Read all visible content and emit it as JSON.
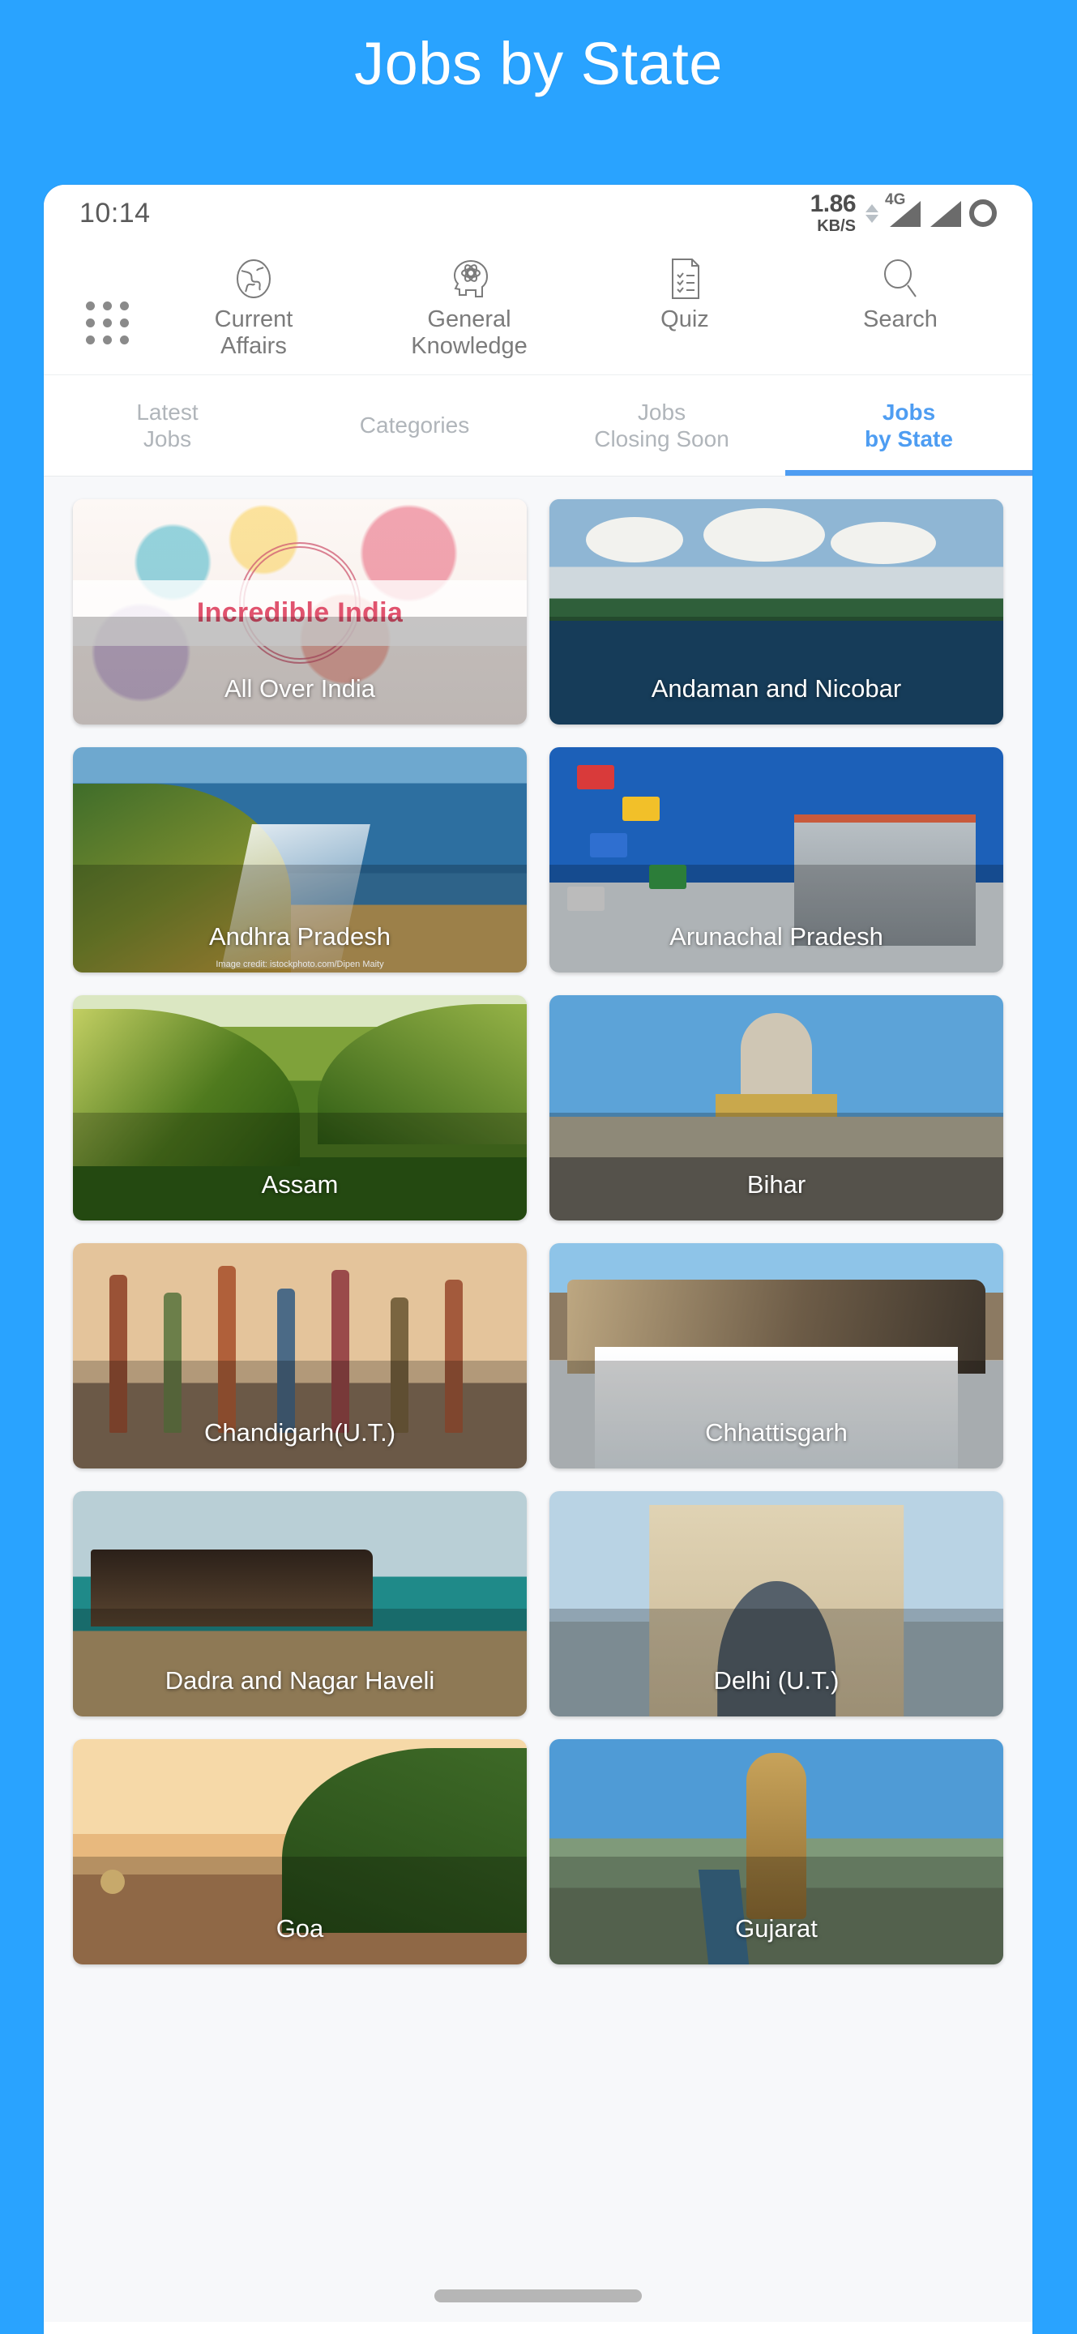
{
  "banner": {
    "title": "Jobs by State",
    "background_color": "#29a3ff"
  },
  "status_bar": {
    "time": "10:14",
    "net_speed_value": "1.86",
    "net_speed_unit": "KB/S",
    "network_type": "4G",
    "icons": [
      "data-up-down-arrows-icon",
      "signal-4g-icon",
      "signal-icon",
      "battery-ring-icon"
    ]
  },
  "top_nav": {
    "grid_icon": "apps-grid-icon",
    "items": [
      {
        "label": "Current\nAffairs",
        "label_line1": "Current",
        "label_line2": "Affairs",
        "icon": "globe-icon"
      },
      {
        "label": "General\nKnowledge",
        "label_line1": "General",
        "label_line2": "Knowledge",
        "icon": "head-atom-icon"
      },
      {
        "label": "Quiz",
        "label_line1": "Quiz",
        "label_line2": "",
        "icon": "quiz-document-icon"
      },
      {
        "label": "Search",
        "label_line1": "Search",
        "label_line2": "",
        "icon": "search-icon"
      }
    ]
  },
  "tabs": {
    "active_color": "#4e9df2",
    "inactive_color": "#b0b5ba",
    "items": [
      {
        "line1": "Latest",
        "line2": "Jobs",
        "active": false
      },
      {
        "line1": "Categories",
        "line2": "",
        "active": false
      },
      {
        "line1": "Jobs",
        "line2": "Closing Soon",
        "active": false
      },
      {
        "line1": "Jobs",
        "line2": "by State",
        "active": true
      }
    ]
  },
  "state_grid": {
    "cards": [
      {
        "label": "All Over India",
        "art": "a-india",
        "badge_text": "Incredible India",
        "credit": ""
      },
      {
        "label": "Andaman and Nicobar",
        "art": "a-andaman",
        "badge_text": "",
        "credit": ""
      },
      {
        "label": "Andhra Pradesh",
        "art": "a-andhra",
        "badge_text": "",
        "credit": "Image credit: istockphoto.com/Dipen Maity"
      },
      {
        "label": "Arunachal Pradesh",
        "art": "a-arunachal",
        "badge_text": "",
        "credit": ""
      },
      {
        "label": "Assam",
        "art": "a-assam",
        "badge_text": "",
        "credit": ""
      },
      {
        "label": "Bihar",
        "art": "a-bihar",
        "badge_text": "",
        "credit": ""
      },
      {
        "label": "Chandigarh(U.T.)",
        "art": "a-chandigarh",
        "badge_text": "",
        "credit": ""
      },
      {
        "label": "Chhattisgarh",
        "art": "a-chhattisgarh",
        "badge_text": "",
        "credit": ""
      },
      {
        "label": "Dadra and Nagar Haveli",
        "art": "a-dadra",
        "badge_text": "",
        "credit": ""
      },
      {
        "label": "Delhi (U.T.)",
        "art": "a-delhi",
        "badge_text": "",
        "credit": ""
      },
      {
        "label": "Goa",
        "art": "a-goa",
        "badge_text": "",
        "credit": ""
      },
      {
        "label": "Gujarat",
        "art": "a-gujarat",
        "badge_text": "",
        "credit": ""
      }
    ]
  },
  "home_indicator": "home-indicator-bar"
}
